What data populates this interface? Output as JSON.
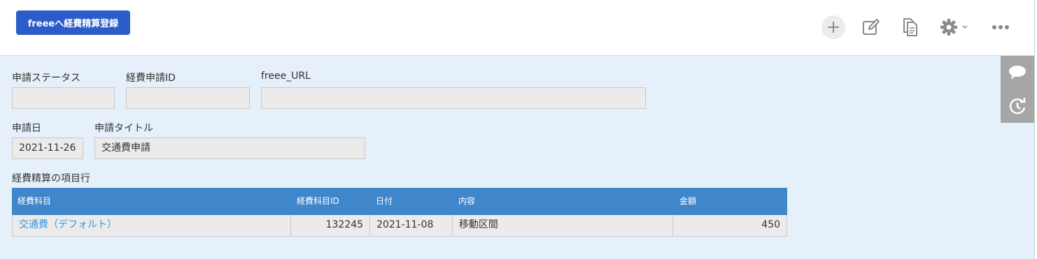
{
  "toolbar": {
    "freee_button_label": "freeeへ経費精算登録",
    "icons": [
      "plus-icon",
      "edit-icon",
      "duplicate-icon",
      "gear-icon",
      "chevron-down-icon",
      "more-icon"
    ]
  },
  "side_rail": {
    "icons": [
      "comment-icon",
      "history-icon"
    ]
  },
  "fields": {
    "status": {
      "label": "申請ステータス",
      "value": ""
    },
    "expense_id": {
      "label": "経費申請ID",
      "value": ""
    },
    "freee_url": {
      "label": "freee_URL",
      "value": ""
    },
    "apply_date": {
      "label": "申請日",
      "value": "2021-11-26"
    },
    "title": {
      "label": "申請タイトル",
      "value": "交通費申請"
    }
  },
  "table": {
    "label": "経費精算の項目行",
    "columns": [
      "経費科目",
      "経費科目ID",
      "日付",
      "内容",
      "金額"
    ],
    "rows": [
      [
        "交通費（デフォルト）",
        "132245",
        "2021-11-08",
        "移動区間",
        "450"
      ]
    ]
  },
  "colors": {
    "primary_button": "#2b5cc9",
    "table_header": "#3f86cb",
    "background": "#e5f0fa",
    "link": "#3498db"
  }
}
